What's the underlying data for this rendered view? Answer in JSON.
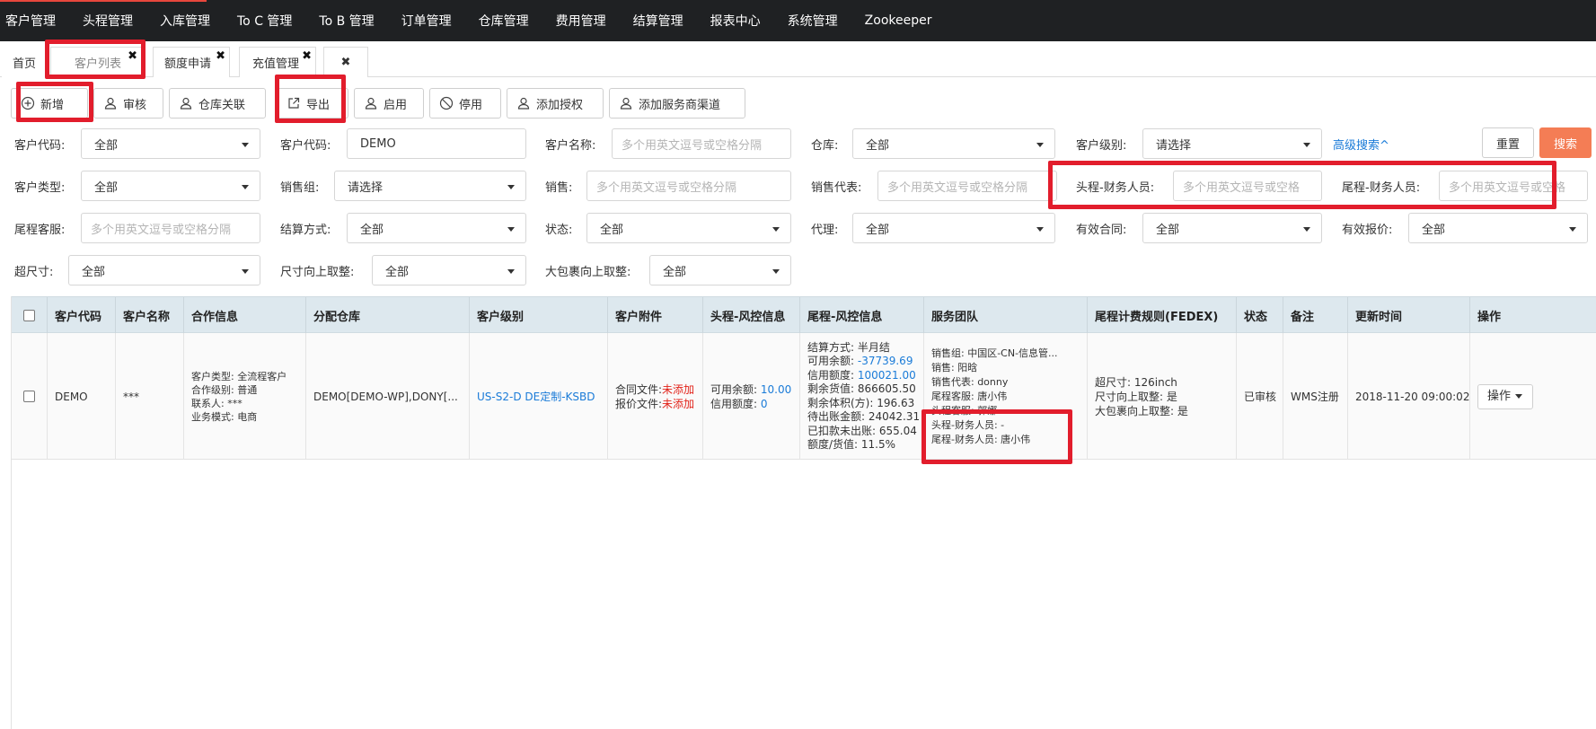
{
  "topnav": [
    "客户管理",
    "头程管理",
    "入库管理",
    "To C 管理",
    "To B 管理",
    "订单管理",
    "仓库管理",
    "费用管理",
    "结算管理",
    "报表中心",
    "系统管理",
    "Zookeeper"
  ],
  "tabs": {
    "home": "首页",
    "customer_list": "客户列表",
    "credit_apply": "额度申请",
    "recharge": "充值管理",
    "close": "✖"
  },
  "toolbar": {
    "add": "新增",
    "audit": "审核",
    "warehouse_link": "仓库关联",
    "export": "导出",
    "enable": "启用",
    "disable": "停用",
    "add_auth": "添加授权",
    "add_channel": "添加服务商渠道"
  },
  "filters": {
    "customer_code_label": "客户代码:",
    "customer_code_select": "全部",
    "customer_code2_label": "客户代码:",
    "customer_code2_value": "DEMO",
    "customer_name_label": "客户名称:",
    "customer_name_placeholder": "多个用英文逗号或空格分隔",
    "warehouse_label": "仓库:",
    "warehouse_value": "全部",
    "level_label": "客户级别:",
    "level_value": "请选择",
    "advanced": "高级搜索^",
    "reset": "重置",
    "search": "搜索",
    "type_label": "客户类型:",
    "type_value": "全部",
    "sales_group_label": "销售组:",
    "sales_group_value": "请选择",
    "sales_label": "销售:",
    "sales_placeholder": "多个用英文逗号或空格分隔",
    "sales_rep_label": "销售代表:",
    "sales_rep_placeholder": "多个用英文逗号或空格分隔",
    "head_finance_label": "头程-财务人员:",
    "head_finance_placeholder": "多个用英文逗号或空格",
    "tail_finance_label": "尾程-财务人员:",
    "tail_finance_placeholder": "多个用英文逗号或空格",
    "tail_service_label": "尾程客服:",
    "tail_service_placeholder": "多个用英文逗号或空格分隔",
    "settle_label": "结算方式:",
    "settle_value": "全部",
    "status_label": "状态:",
    "status_value": "全部",
    "agent_label": "代理:",
    "agent_value": "全部",
    "contract_label": "有效合同:",
    "contract_value": "全部",
    "quote_label": "有效报价:",
    "quote_value": "全部",
    "oversize_label": "超尺寸:",
    "oversize_value": "全部",
    "size_round_label": "尺寸向上取整:",
    "size_round_value": "全部",
    "big_pkg_label": "大包裹向上取整:",
    "big_pkg_value": "全部"
  },
  "table": {
    "headers": [
      "客户代码",
      "客户名称",
      "合作信息",
      "分配仓库",
      "客户级别",
      "客户附件",
      "头程-风控信息",
      "尾程-风控信息",
      "服务团队",
      "尾程计费规则(FEDEX)",
      "状态",
      "备注",
      "更新时间",
      "操作"
    ],
    "row": {
      "code": "DEMO",
      "name": "***",
      "coop": [
        "客户类型: 全流程客户",
        "合作级别: 普通",
        "联系人: ***",
        "业务模式: 电商"
      ],
      "warehouse": "DEMO[DEMO-WP],DONY[...",
      "level": "US-S2-D DE定制-KSBD",
      "attach_contract_label": "合同文件:",
      "attach_contract_value": "未添加",
      "attach_quote_label": "报价文件:",
      "attach_quote_value": "未添加",
      "head_balance_label": "可用余额: ",
      "head_balance_value": "10.00",
      "head_credit_label": "信用额度: ",
      "head_credit_value": "0",
      "tail_settle": "结算方式: 半月结",
      "tail_balance_label": "可用余额: ",
      "tail_balance_value": "-37739.69",
      "tail_credit_label": "信用额度: ",
      "tail_credit_value": "100021.00",
      "tail_goods": "剩余货值: 866605.50",
      "tail_volume": "剩余体积(方): 196.63",
      "tail_pending": "待出账金额: 24042.31",
      "tail_deducted": "已扣款未出账: 655.04",
      "tail_ratio": "额度/货值: 11.5%",
      "team": [
        "销售组: 中国区-CN-信息管...",
        "销售: 阳晗",
        "销售代表: donny",
        "尾程客服: 唐小伟",
        "头程客服: 郭娜",
        "头程-财务人员: -",
        "尾程-财务人员: 唐小伟"
      ],
      "rule": [
        "超尺寸: 126inch",
        "尺寸向上取整: 是",
        "大包裹向上取整: 是"
      ],
      "status": "已审核",
      "remark": "WMS注册",
      "updated": "2018-11-20 09:00:02",
      "op": "操作"
    }
  }
}
